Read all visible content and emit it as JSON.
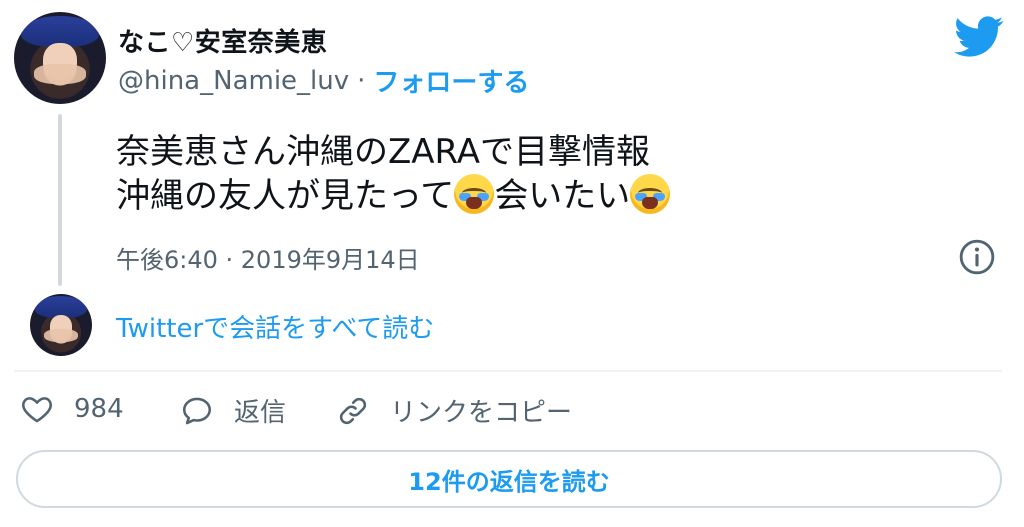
{
  "author": {
    "name": "なこ♡安室奈美恵",
    "handle": "@hina_Namie_luv",
    "separator": "·",
    "follow_label": "フォローする"
  },
  "brand": {
    "icon": "twitter-bird-icon",
    "color": "#1d9bf0"
  },
  "tweet": {
    "line1": "奈美恵さん沖縄のZARAで目撃情報",
    "line2_part1": "沖縄の友人が見たって",
    "line2_part2": "会いたい",
    "emoji": "loudly-crying-face-icon",
    "timestamp": "午後6:40 · 2019年9月14日",
    "info_icon": "info-icon"
  },
  "conversation": {
    "label": "Twitterで会話をすべて読む"
  },
  "actions": {
    "like_count": "984",
    "reply_label": "返信",
    "copy_link_label": "リンクをコピー"
  },
  "replies_button": {
    "label": "12件の返信を読む"
  }
}
